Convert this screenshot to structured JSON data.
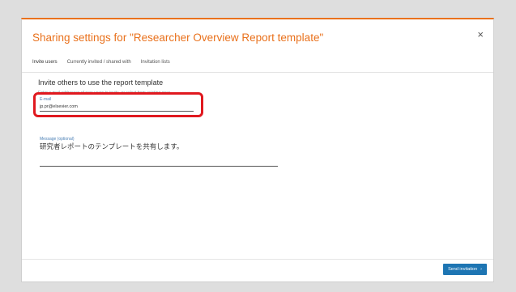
{
  "dialog": {
    "title": "Sharing settings for \"Researcher Overview Report template\"",
    "close_glyph": "×"
  },
  "tabs": [
    {
      "label": "Invite users",
      "active": true
    },
    {
      "label": "Currently invited / shared with",
      "active": false
    },
    {
      "label": "Invitation lists",
      "active": false
    }
  ],
  "invite": {
    "heading": "Invite others to use the report template",
    "hint": "Enter e-mail addresses of new users to invite, or select from existing ones.",
    "email_label": "E-mail",
    "email_value": "jp.pr@elsevier.com",
    "message_label": "Message (optional)",
    "message_value": "研究者レポートのテンプレートを共有します。"
  },
  "footer": {
    "send_label": "Send invitation",
    "send_chevron": "›"
  },
  "colors": {
    "accent": "#e9711c",
    "primary": "#1d75b3",
    "highlight": "#e0191f"
  }
}
